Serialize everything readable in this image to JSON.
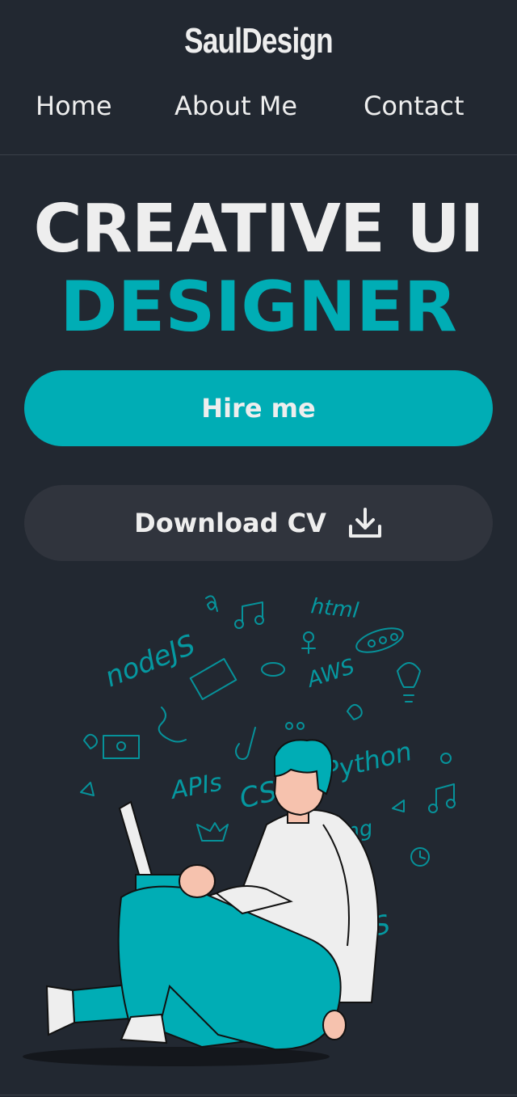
{
  "brand": "SaulDesign",
  "nav": {
    "home": "Home",
    "about": "About Me",
    "contact": "Contact"
  },
  "hero": {
    "line1": "CREATIVE UI",
    "line2": "DESIGNER"
  },
  "buttons": {
    "hire": "Hire me",
    "download": "Download CV"
  },
  "illustration": {
    "doodles": [
      "nodeJS",
      "html",
      "AWS",
      "APIs",
      "CSS",
      "Python",
      "ng",
      "JS"
    ]
  },
  "colors": {
    "background": "#222831",
    "accent": "#00ADB5",
    "text": "#EEEEEE",
    "secondary_button": "#30343d"
  },
  "icons": {
    "download": "download-icon"
  }
}
